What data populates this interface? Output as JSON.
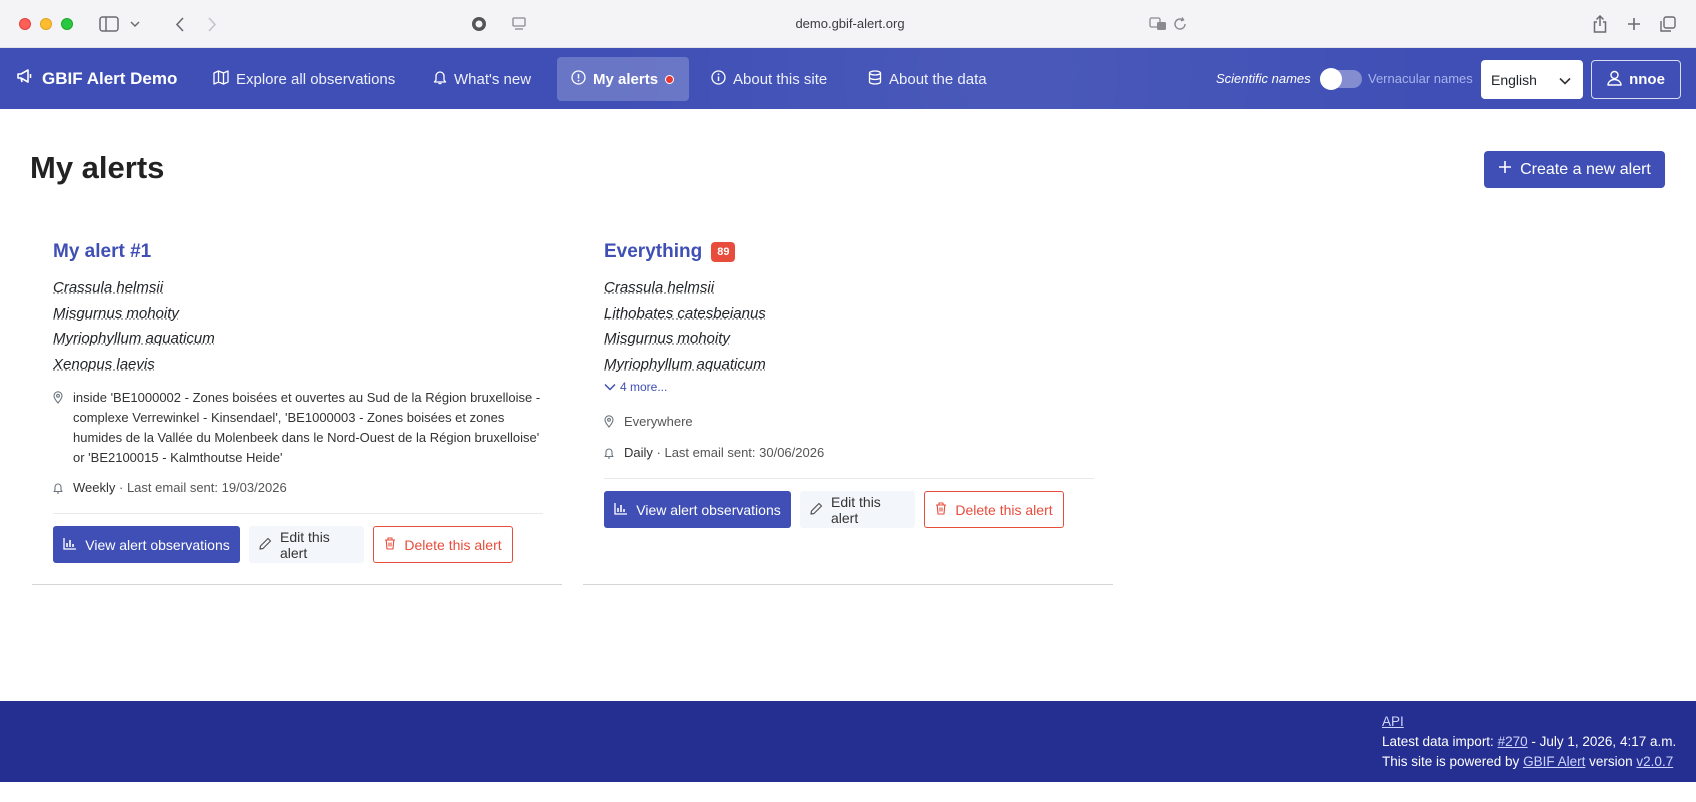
{
  "browser": {
    "url": "demo.gbif-alert.org"
  },
  "navbar": {
    "brand": "GBIF Alert Demo",
    "items": [
      {
        "label": "Explore all observations"
      },
      {
        "label": "What's new"
      },
      {
        "label": "My alerts"
      },
      {
        "label": "About this site"
      },
      {
        "label": "About the data"
      }
    ],
    "scientific_names": "Scientific names",
    "vernacular_names": "Vernacular names",
    "language": "English",
    "user": "nnoe"
  },
  "main": {
    "title": "My alerts",
    "create_button": "Create a new alert"
  },
  "alerts": [
    {
      "title": "My alert #1",
      "species": [
        "Crassula helmsii",
        "Misgurnus mohoity",
        "Myriophyllum aquaticum",
        "Xenopus laevis"
      ],
      "location": "inside 'BE1000002 - Zones boisées et ouvertes au Sud de la Région bruxelloise - complexe Verrewinkel - Kinsendael', 'BE1000003 - Zones boisées et zones humides de la Vallée du Molenbeek dans le Nord-Ouest de la Région bruxelloise' or 'BE2100015 - Kalmthoutse Heide'",
      "frequency": "Weekly",
      "last_email": "· Last email sent: 19/03/2026",
      "view_button": "View alert observations",
      "edit_button": "Edit this alert",
      "delete_button": "Delete this alert"
    },
    {
      "title": "Everything",
      "badge": "89",
      "species": [
        "Crassula helmsii",
        "Lithobates catesbeianus",
        "Misgurnus mohoity",
        "Myriophyllum aquaticum"
      ],
      "more": "4 more...",
      "location": "Everywhere",
      "frequency": "Daily",
      "last_email": "· Last email sent: 30/06/2026",
      "view_button": "View alert observations",
      "edit_button": "Edit this alert",
      "delete_button": "Delete this alert"
    }
  ],
  "footer": {
    "api": "API",
    "import_prefix": "Latest data import:",
    "import_link": "#270",
    "import_suffix": "- July 1, 2026, 4:17 a.m.",
    "powered_prefix": "This site is powered by",
    "powered_link": "GBIF Alert",
    "version_prefix": "version",
    "version_link": "v2.0.7"
  },
  "colors": {
    "primary": "#3f4fb5",
    "footer": "#252f91",
    "danger": "#e74c3c"
  }
}
